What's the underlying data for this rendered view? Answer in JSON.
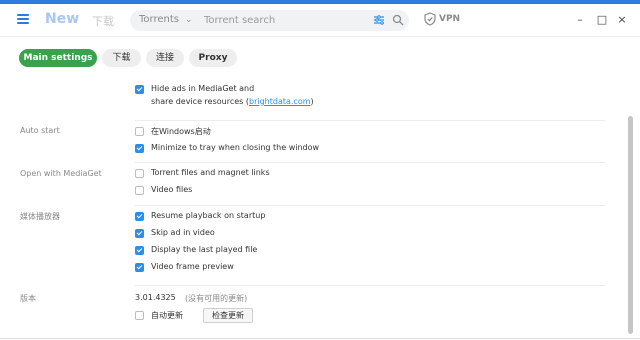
{
  "app": {
    "nav": {
      "new": "New",
      "downloads": "下载"
    },
    "search": {
      "category": "Torrents",
      "placeholder": "Torrent search"
    },
    "vpn_label": "VPN",
    "window_controls": {
      "minimize": "–",
      "maximize": "□",
      "close": "×"
    }
  },
  "tabs": [
    {
      "label": "Main settings",
      "active": true
    },
    {
      "label": "下载",
      "active": false
    },
    {
      "label": "连接",
      "active": false
    },
    {
      "label": "Proxy",
      "active": false
    }
  ],
  "settings": {
    "ads": {
      "line1": "Hide ads in MediaGet and",
      "line2_prefix": "share device resources (",
      "link": "brightdata.com",
      "line2_suffix": ")",
      "checked": true
    },
    "auto_start": {
      "label": "Auto start",
      "items": [
        {
          "text": "在Windows启动",
          "checked": false
        },
        {
          "text": "Minimize to tray when closing the window",
          "checked": true
        }
      ]
    },
    "open_with": {
      "label": "Open with MediaGet",
      "items": [
        {
          "text": "Torrent files and magnet links",
          "checked": false
        },
        {
          "text": "Video files",
          "checked": false
        }
      ]
    },
    "media_player": {
      "label": "媒体播放器",
      "items": [
        {
          "text": "Resume playback on startup",
          "checked": true
        },
        {
          "text": "Skip ad in video",
          "checked": true
        },
        {
          "text": "Display the last played file",
          "checked": true
        },
        {
          "text": "Video frame preview",
          "checked": true
        }
      ]
    },
    "version": {
      "label": "版本",
      "number": "3.01.4325",
      "note": "(没有可用的更新)",
      "auto_update": {
        "text": "自动更新",
        "checked": false
      },
      "check_button": "检查更新"
    }
  },
  "colors": {
    "accent": "#2b7be0",
    "active_tab": "#3aa24c",
    "checkbox": "#2b8ee8"
  }
}
